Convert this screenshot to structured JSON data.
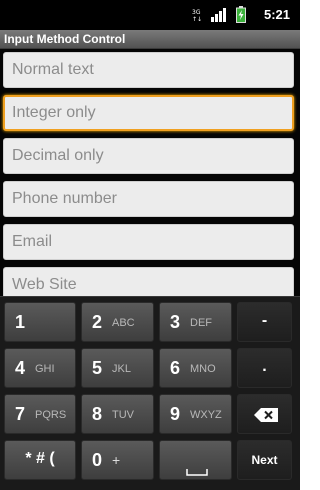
{
  "status_bar": {
    "time": "5:21",
    "icons": [
      "sim-card-icon",
      "signal-bars-icon",
      "battery-charging-icon"
    ]
  },
  "title_bar": {
    "title": "Input Method Control"
  },
  "fields": [
    {
      "placeholder": "Normal text",
      "focused": false
    },
    {
      "placeholder": "Integer only",
      "focused": true
    },
    {
      "placeholder": "Decimal only",
      "focused": false
    },
    {
      "placeholder": "Phone number",
      "focused": false
    },
    {
      "placeholder": "Email",
      "focused": false
    },
    {
      "placeholder": "Web Site",
      "focused": false
    }
  ],
  "keyboard": {
    "rows": [
      [
        {
          "num": "1",
          "letters": ""
        },
        {
          "num": "2",
          "letters": "ABC"
        },
        {
          "num": "3",
          "letters": "DEF"
        },
        {
          "label": "-"
        }
      ],
      [
        {
          "num": "4",
          "letters": "GHI"
        },
        {
          "num": "5",
          "letters": "JKL"
        },
        {
          "num": "6",
          "letters": "MNO"
        },
        {
          "label": "."
        }
      ],
      [
        {
          "num": "7",
          "letters": "PQRS"
        },
        {
          "num": "8",
          "letters": "TUV"
        },
        {
          "num": "9",
          "letters": "WXYZ"
        },
        {
          "icon": "backspace-icon"
        }
      ],
      [
        {
          "label": "* # ("
        },
        {
          "num": "0",
          "letters": "+"
        },
        {
          "icon": "space-icon"
        },
        {
          "label": "Next"
        }
      ]
    ]
  },
  "colors": {
    "focus_border": "#f0a020",
    "field_bg": "#ececec",
    "key_bg": "#4a4a4a",
    "keyboard_bg": "#1a1a1a"
  }
}
